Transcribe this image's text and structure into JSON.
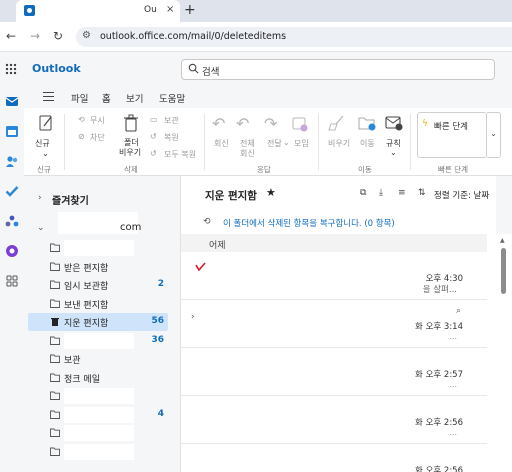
{
  "browser": {
    "tab_title": "Ou",
    "tab_close": "×",
    "new_tab": "+",
    "back": "←",
    "forward": "→",
    "reload": "↻",
    "url": "outlook.office.com/mail/0/deleteditems"
  },
  "outlook": {
    "brand": "Outlook",
    "search_placeholder": "검색",
    "accent_color": "#0f6cbd"
  },
  "menu": {
    "tabs": [
      "파일",
      "홈",
      "보기",
      "도움말"
    ],
    "active": "홈"
  },
  "ribbon": {
    "new": {
      "label": "신규",
      "group": "신규"
    },
    "delete_group": {
      "ignore": "무시",
      "block": "차단",
      "empty_folder_line1": "폴더",
      "empty_folder_line2": "비우기",
      "archive": "보관",
      "restore": "복원",
      "restore_all": "모두 복원",
      "group": "삭제"
    },
    "respond_group": {
      "reply": "회신",
      "reply_all_line1": "전체",
      "reply_all_line2": "회신",
      "forward": "전달",
      "meeting": "모임",
      "group": "응답"
    },
    "move_group": {
      "sweep": "비우기",
      "move": "이동",
      "rules": "규칙",
      "group": "이동"
    },
    "quick_steps": {
      "label": "빠른 단계",
      "group": "빠른 단계"
    }
  },
  "folders": {
    "favorites": "즐겨찾기",
    "account_suffix": "com",
    "items": [
      {
        "name": "",
        "count": "",
        "masked": true
      },
      {
        "name": "받은 편지함",
        "count": ""
      },
      {
        "name": "임시 보관함",
        "count": "2"
      },
      {
        "name": "보낸 편지함",
        "count": ""
      },
      {
        "name": "지운 편지함",
        "count": "56",
        "selected": true
      },
      {
        "name": "",
        "count": "36",
        "masked": true
      },
      {
        "name": "보관",
        "count": ""
      },
      {
        "name": "정크 메일",
        "count": ""
      },
      {
        "name": "",
        "count": "",
        "masked": true
      },
      {
        "name": "",
        "count": "4",
        "masked": true
      },
      {
        "name": "",
        "count": "",
        "masked": true
      },
      {
        "name": "",
        "count": "",
        "masked": true
      }
    ]
  },
  "list": {
    "title": "지운 편지함",
    "sort_label": "정렬 기준: 날짜",
    "recover_text": "이 폴더에서 삭제된 항목을 복구합니다. (0 항목)",
    "section": "어제",
    "messages": [
      {
        "time": "오후 4:30",
        "preview": "을 살펴..."
      },
      {
        "time": "화 오후 3:14",
        "preview": ""
      },
      {
        "time": "화 오후 2:57",
        "preview": ""
      },
      {
        "time": "화 오후 2:56",
        "preview": ""
      },
      {
        "time": "화 오후 2:56",
        "preview": ""
      }
    ]
  }
}
